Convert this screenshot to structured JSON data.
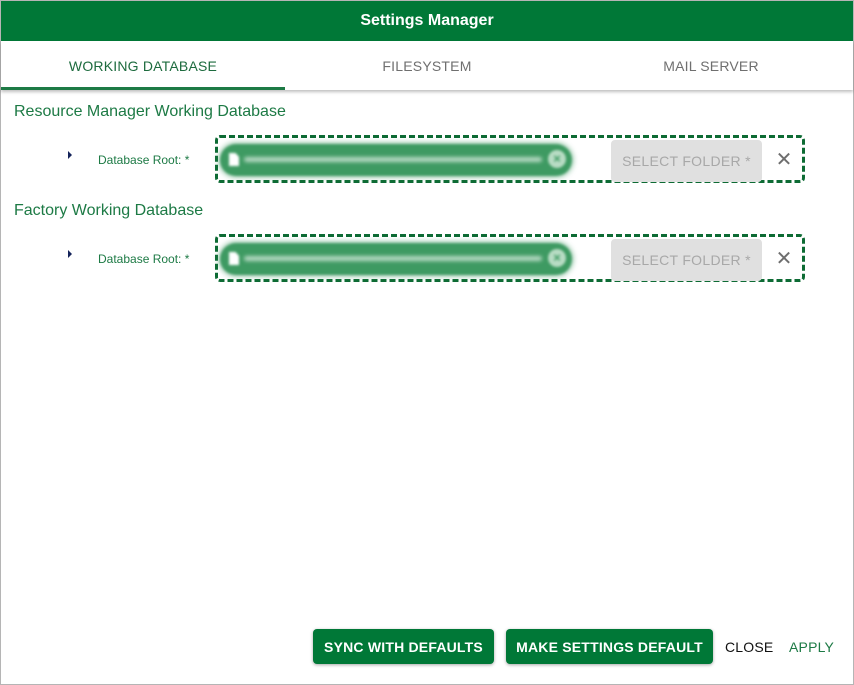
{
  "dialog": {
    "title": "Settings Manager"
  },
  "tabs": [
    {
      "label": "WORKING DATABASE",
      "active": true
    },
    {
      "label": "FILESYSTEM",
      "active": false
    },
    {
      "label": "MAIL SERVER",
      "active": false
    }
  ],
  "sections": [
    {
      "title": "Resource Manager Working Database",
      "field": {
        "label": "Database Root: *",
        "value_blurred": true,
        "select_label": "SELECT FOLDER *",
        "clear_icon": "close-icon"
      }
    },
    {
      "title": "Factory Working Database",
      "field": {
        "label": "Database Root: *",
        "value_blurred": true,
        "select_label": "SELECT FOLDER *",
        "clear_icon": "close-icon"
      }
    }
  ],
  "footer": {
    "sync_label": "SYNC WITH DEFAULTS",
    "make_default_label": "MAKE SETTINGS DEFAULT",
    "close_label": "CLOSE",
    "apply_label": "APPLY"
  },
  "colors": {
    "primary": "#007837",
    "accent_text": "#1d7a45",
    "disabled_bg": "#e0e0e0"
  }
}
